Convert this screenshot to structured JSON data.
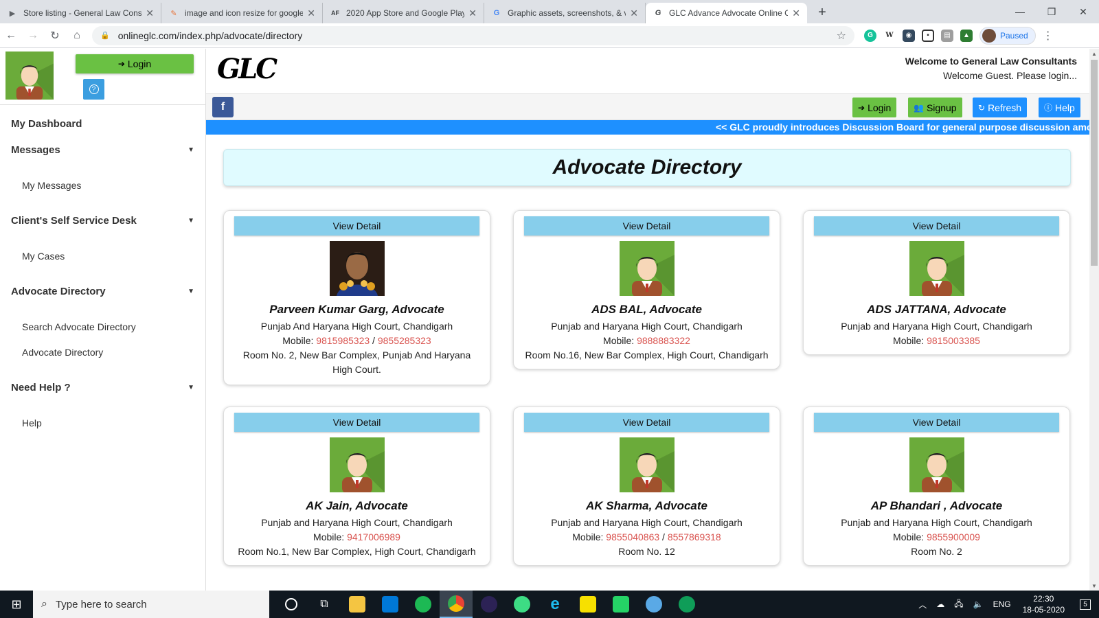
{
  "browser": {
    "tabs": [
      {
        "title": "Store listing - General Law Consu",
        "icon": "play-console-icon",
        "color": "#5f6368",
        "active": false
      },
      {
        "title": "image and icon resize for google",
        "icon": "resize-icon",
        "color": "#e8743b",
        "active": false
      },
      {
        "title": "2020 App Store and Google Play",
        "icon": "af-icon",
        "color": "#111111",
        "active": false
      },
      {
        "title": "Graphic assets, screenshots, & vi",
        "icon": "google-icon",
        "color": "#4285f4",
        "active": false
      },
      {
        "title": "GLC Advance Advocate Online C",
        "icon": "glc-icon",
        "color": "#111111",
        "active": true
      }
    ],
    "url": "onlineglc.com/index.php/advocate/directory",
    "profile_status": "Paused"
  },
  "sidebar": {
    "login_label": "Login",
    "help_label": "?",
    "dashboard_label": "My Dashboard",
    "sections": [
      {
        "title": "Messages",
        "items": [
          "My Messages"
        ]
      },
      {
        "title": "Client's Self Service Desk",
        "items": [
          "My Cases"
        ]
      },
      {
        "title": "Advocate Directory",
        "items": [
          "Search Advocate Directory",
          "Advocate Directory"
        ]
      },
      {
        "title": "Need Help ?",
        "items": [
          "Help"
        ]
      }
    ]
  },
  "header": {
    "logo_text": "GLC",
    "welcome_title": "Welcome to General Law Consultants",
    "welcome_guest": "Welcome Guest. Please login...",
    "facebook_label": "f",
    "buttons": {
      "login": "Login",
      "signup": "Signup",
      "refresh": "Refresh",
      "help": "Help"
    },
    "marquee": "<< GLC proudly introduces Discussion Board for general purpose discussion among all the"
  },
  "directory": {
    "title": "Advocate Directory",
    "view_detail_label": "View Detail",
    "mobile_label": "Mobile:",
    "advocates": [
      {
        "name": "Parveen Kumar Garg, Advocate",
        "court": "Punjab And Haryana High Court, Chandigarh",
        "mobile1": "9815985323",
        "mobile2": "9855285323",
        "address": "Room No. 2, New Bar Complex, Punjab And Haryana High Court.",
        "photo": "real-photo"
      },
      {
        "name": "ADS BAL, Advocate",
        "court": "Punjab and Haryana High Court, Chandigarh",
        "mobile1": "9888883322",
        "mobile2": "",
        "address": "Room No.16, New Bar Complex, High Court, Chandigarh",
        "photo": "default-avatar"
      },
      {
        "name": "ADS JATTANA, Advocate",
        "court": "Punjab and Haryana High Court, Chandigarh",
        "mobile1": "9815003385",
        "mobile2": "",
        "address": "",
        "photo": "default-avatar"
      },
      {
        "name": "AK Jain, Advocate",
        "court": "Punjab and Haryana High Court, Chandigarh",
        "mobile1": "9417006989",
        "mobile2": "",
        "address": "Room No.1, New Bar Complex, High Court, Chandigarh",
        "photo": "default-avatar"
      },
      {
        "name": "AK Sharma, Advocate",
        "court": "Punjab and Haryana High Court, Chandigarh",
        "mobile1": "9855040863",
        "mobile2": "8557869318",
        "address": "Room No. 12",
        "photo": "default-avatar"
      },
      {
        "name": "AP Bhandari , Advocate",
        "court": "Punjab and Haryana High Court, Chandigarh",
        "mobile1": "9855900009",
        "mobile2": "",
        "address": "Room No. 2",
        "photo": "default-avatar"
      }
    ]
  },
  "taskbar": {
    "search_placeholder": "Type here to search",
    "language": "ENG",
    "time": "22:30",
    "date": "18-05-2020",
    "notification_count": "5"
  },
  "colors": {
    "accent_green": "#6ac143",
    "accent_blue": "#1e90ff",
    "view_detail": "#87ceeb",
    "phone_red": "#d9534f"
  }
}
